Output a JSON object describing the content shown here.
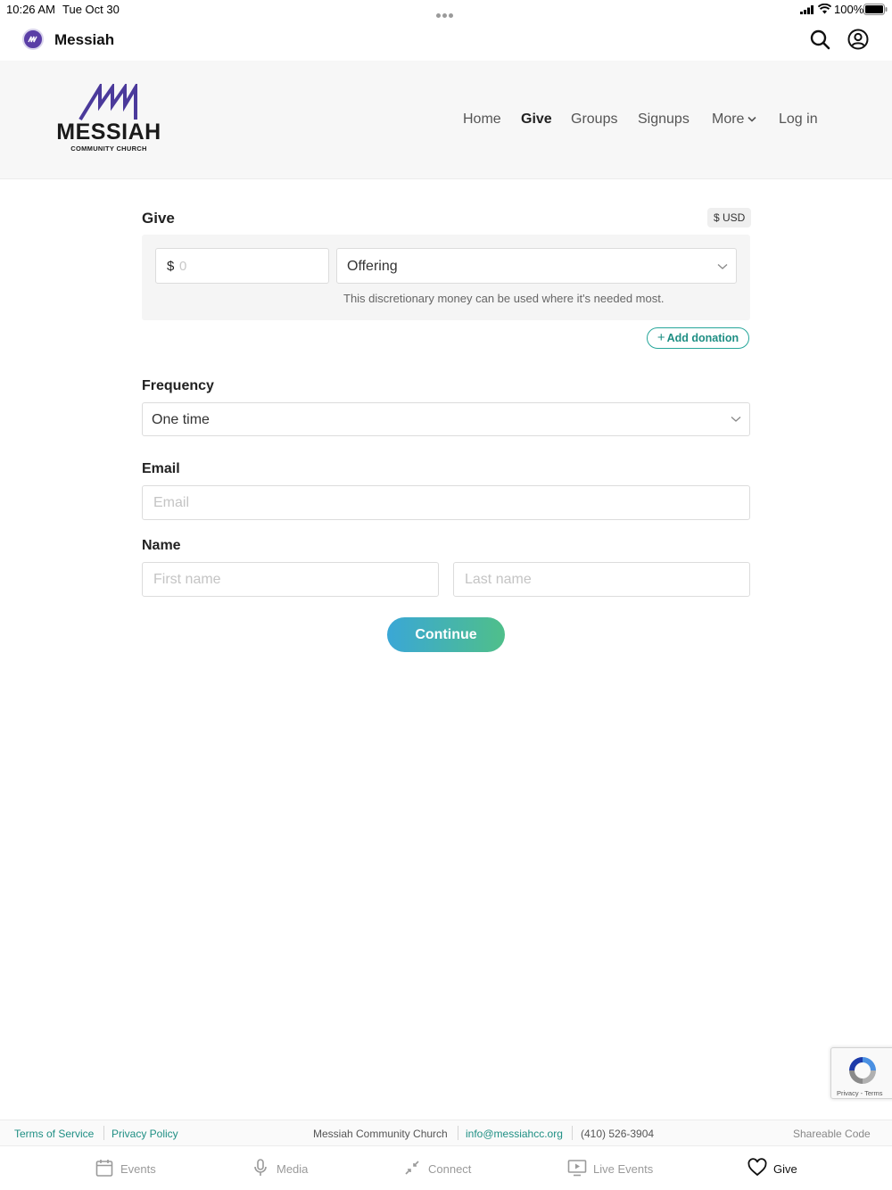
{
  "status_bar": {
    "time": "10:26 AM",
    "date": "Tue Oct 30",
    "battery": "100%"
  },
  "app_bar": {
    "title": "Messiah"
  },
  "site_header": {
    "logo_word": "MESSIAH",
    "logo_sub": "COMMUNITY CHURCH",
    "nav": [
      "Home",
      "Give",
      "Groups",
      "Signups",
      "More",
      "Log in"
    ],
    "active_nav": "Give"
  },
  "give": {
    "title": "Give",
    "currency": "$ USD",
    "amount_symbol": "$",
    "amount_placeholder": "0",
    "fund": "Offering",
    "fund_description": "This discretionary money can be used where it's needed most.",
    "add_donation": "Add donation"
  },
  "frequency": {
    "label": "Frequency",
    "value": "One time"
  },
  "email": {
    "label": "Email",
    "placeholder": "Email"
  },
  "name": {
    "label": "Name",
    "first_placeholder": "First name",
    "last_placeholder": "Last name"
  },
  "continue_label": "Continue",
  "recaptcha": {
    "text": "Privacy - Terms"
  },
  "footer": {
    "terms": "Terms of Service",
    "privacy": "Privacy Policy",
    "org": "Messiah Community Church",
    "email": "info@messiahcc.org",
    "phone": "(410) 526-3904",
    "shareable": "Shareable Code"
  },
  "tab_bar": {
    "items": [
      "Events",
      "Media",
      "Connect",
      "Live Events",
      "Give"
    ],
    "active": "Give"
  },
  "colors": {
    "brand_purple": "#4b3a9b",
    "accent_teal": "#1f8f84",
    "button_gradient_start": "#3aa7d6",
    "button_gradient_end": "#4fbf8a"
  }
}
